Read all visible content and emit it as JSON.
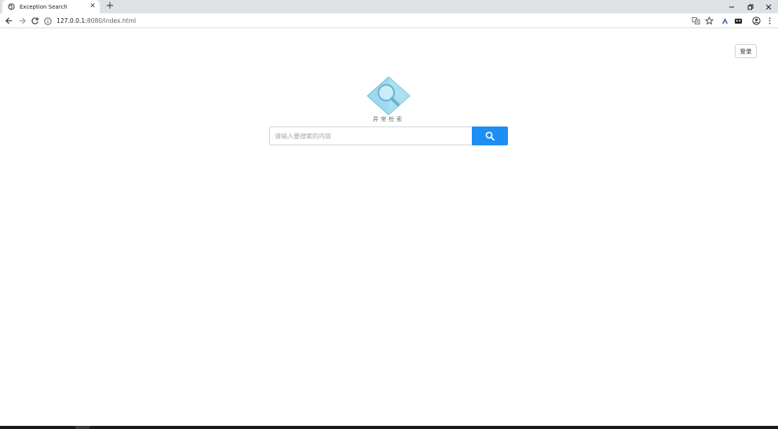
{
  "browser": {
    "tab": {
      "title": "Exception Search",
      "close_icon": "close-icon",
      "favicon": "globe-icon"
    },
    "new_tab_label": "+",
    "window_controls": [
      "minimize-icon",
      "restore-icon",
      "close-icon"
    ],
    "address": {
      "host": "127.0.0.1",
      "rest": ":8080/index.html"
    },
    "toolbar_icons": [
      "translate-icon",
      "star-icon",
      "extension-icon",
      "extension-icon",
      "profile-icon",
      "menu-icon"
    ]
  },
  "page": {
    "login_label": "登录",
    "logo": {
      "caption": "异常检索",
      "icon": "magnifier-icon"
    },
    "search": {
      "placeholder": "请输入要搜索的内容",
      "value": "",
      "button_icon": "search-icon"
    }
  },
  "colors": {
    "accent": "#1e8ef2",
    "logo_fill": "#9fd9ef",
    "logo_stroke": "#6cb2cf"
  }
}
